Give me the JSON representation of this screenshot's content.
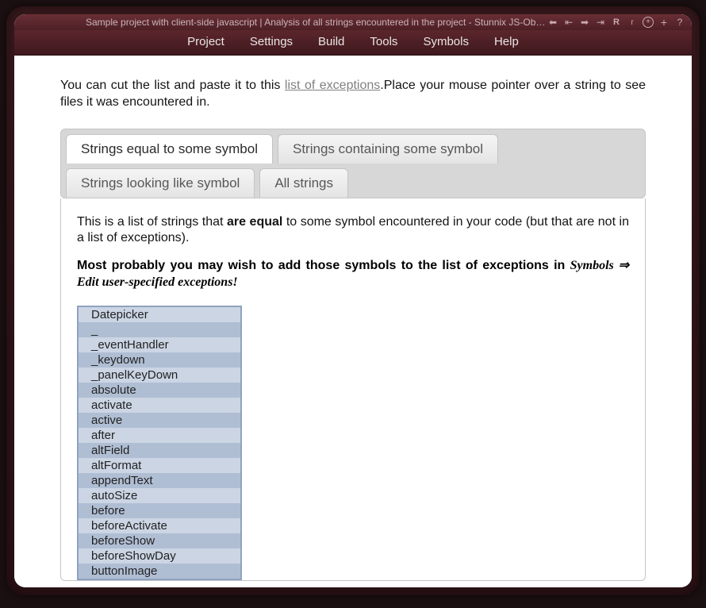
{
  "titlebar": {
    "text": "Sample project with client-side javascript | Analysis of all strings encountered in the project - Stunnix JS-Obfus Pr"
  },
  "menubar": {
    "items": [
      "Project",
      "Settings",
      "Build",
      "Tools",
      "Symbols",
      "Help"
    ]
  },
  "intro": {
    "prefix": "You can cut the list and paste it to this ",
    "link": "list of exceptions",
    "suffix": ".Place your mouse pointer over a string to see files it was encountered in."
  },
  "tabs": {
    "items": [
      {
        "label": "Strings equal to some symbol",
        "active": true
      },
      {
        "label": "Strings containing some symbol",
        "active": false
      },
      {
        "label": "Strings looking like symbol",
        "active": false
      },
      {
        "label": "All strings",
        "active": false
      }
    ]
  },
  "desc": {
    "p1a": "This is a list of strings that ",
    "p1bold": "are equal",
    "p1b": " to some symbol encountered in your code (but that are not in a list of exceptions)."
  },
  "advice": {
    "lead": "Most probably you may wish to add those symbols to the list of exceptions in ",
    "path": "Symbols ⇒ Edit user-specified exceptions!"
  },
  "strings": [
    "Datepicker",
    "_",
    "_eventHandler",
    "_keydown",
    "_panelKeyDown",
    "absolute",
    "activate",
    "active",
    "after",
    "altField",
    "altFormat",
    "appendText",
    "autoSize",
    "before",
    "beforeActivate",
    "beforeShow",
    "beforeShowDay",
    "buttonImage"
  ]
}
